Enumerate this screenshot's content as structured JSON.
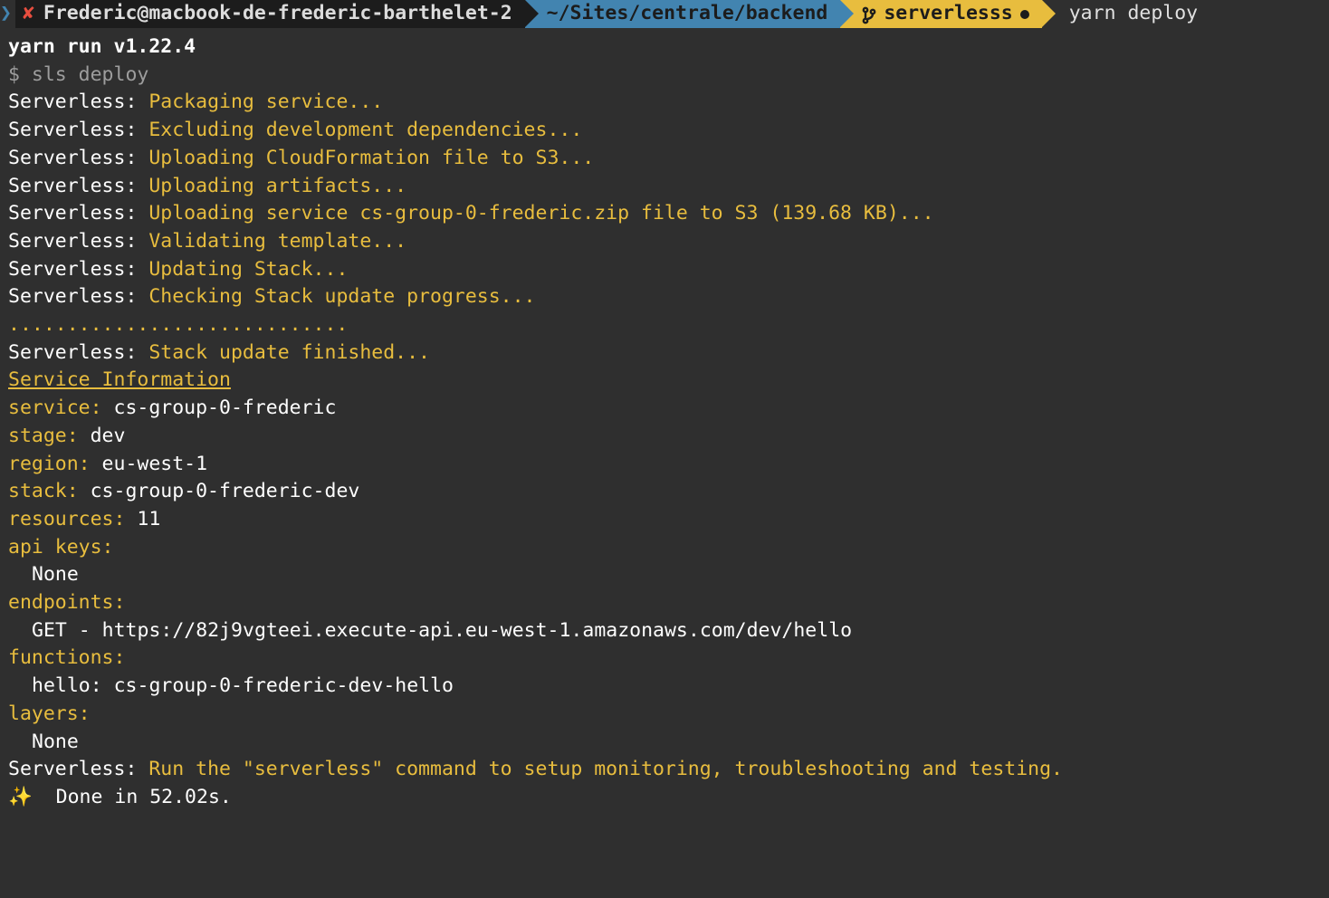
{
  "prompt": {
    "close_glyph": "✘",
    "user_host": "Frederic@macbook-de-frederic-barthelet-2",
    "cwd": "~/Sites/centrale/backend",
    "branch": "serverlesss",
    "command": "yarn deploy"
  },
  "body": {
    "yarn_run": "yarn run v1.22.4",
    "sls_cmd": "$ sls deploy",
    "sls_label": "Serverless: ",
    "steps": [
      "Packaging service...",
      "Excluding development dependencies...",
      "Uploading CloudFormation file to S3...",
      "Uploading artifacts...",
      "Uploading service cs-group-0-frederic.zip file to S3 (139.68 KB)...",
      "Validating template...",
      "Updating Stack...",
      "Checking Stack update progress..."
    ],
    "dots": ".............................",
    "stack_finished": "Stack update finished...",
    "svc_info_heading": "Service Information",
    "info": {
      "service_k": "service:",
      "service_v": " cs-group-0-frederic",
      "stage_k": "stage:",
      "stage_v": " dev",
      "region_k": "region:",
      "region_v": " eu-west-1",
      "stack_k": "stack:",
      "stack_v": " cs-group-0-frederic-dev",
      "resources_k": "resources:",
      "resources_v": " 11",
      "apikeys_k": "api keys:",
      "apikeys_v": "None",
      "endpoints_k": "endpoints:",
      "endpoints_v": "GET - https://82j9vgteei.execute-api.eu-west-1.amazonaws.com/dev/hello",
      "functions_k": "functions:",
      "functions_v": "hello: cs-group-0-frederic-dev-hello",
      "layers_k": "layers:",
      "layers_v": "None"
    },
    "final_hint": "Run the \"serverless\" command to setup monitoring, troubleshooting and testing.",
    "done_glyph": "✨",
    "done_text": "  Done in 52.02s."
  }
}
